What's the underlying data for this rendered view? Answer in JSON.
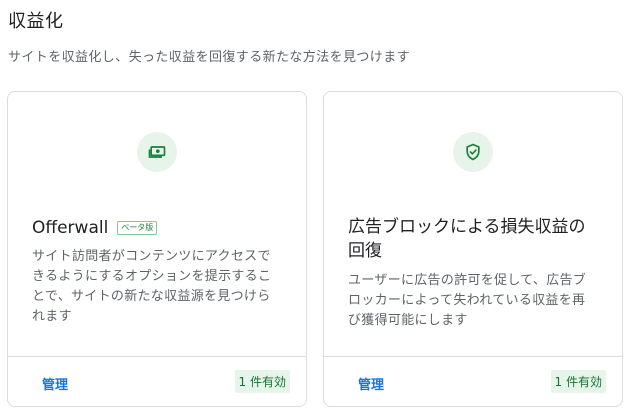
{
  "page": {
    "title": "収益化",
    "subtitle": "サイトを収益化し、失った収益を回復する新たな方法を見つけます"
  },
  "cards": [
    {
      "icon": "money-icon",
      "title": "Offerwall",
      "badge": "ベータ版",
      "description": "サイト訪問者がコンテンツにアクセスできるようにするオプションを提示することで、サイトの新たな収益源を見つけられます",
      "action_label": "管理",
      "status": "1 件有効"
    },
    {
      "icon": "shield-check-icon",
      "title": "広告ブロックによる損失収益の回復",
      "description": "ユーザーに広告の許可を促して、広告ブロッカーによって失われている収益を再び獲得可能にします",
      "action_label": "管理",
      "status": "1 件有効"
    }
  ],
  "colors": {
    "accent_green": "#188038",
    "icon_bg": "#e6f4ea",
    "link_blue": "#1a73e8"
  }
}
